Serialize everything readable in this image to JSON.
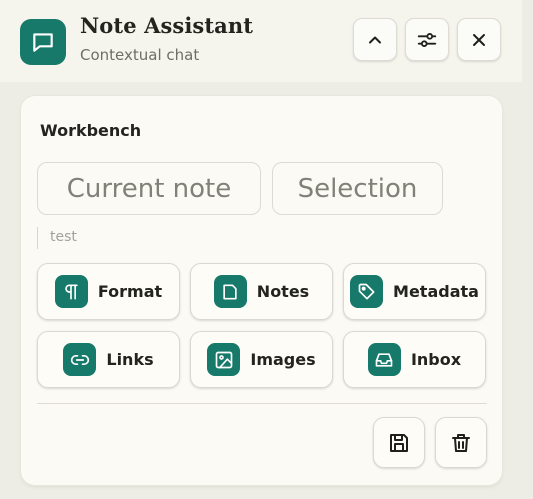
{
  "header": {
    "app_icon": "chat-bubble-icon",
    "title": "Note Assistant",
    "subtitle": "Contextual chat",
    "buttons": [
      {
        "icon": "chevron-up-icon"
      },
      {
        "icon": "sliders-icon"
      },
      {
        "icon": "close-icon"
      }
    ]
  },
  "workbench": {
    "title": "Workbench",
    "context_chips": [
      {
        "label": "Current note"
      },
      {
        "label": "Selection"
      }
    ],
    "input": {
      "value": "test"
    },
    "tools": [
      {
        "label": "Format",
        "icon": "pilcrow-icon"
      },
      {
        "label": "Notes",
        "icon": "note-page-icon"
      },
      {
        "label": "Metadata",
        "icon": "tag-icon"
      },
      {
        "label": "Links",
        "icon": "link-icon"
      },
      {
        "label": "Images",
        "icon": "image-icon"
      },
      {
        "label": "Inbox",
        "icon": "inbox-icon"
      }
    ],
    "actions": [
      {
        "icon": "save-icon"
      },
      {
        "icon": "trash-icon"
      }
    ]
  },
  "colors": {
    "accent": "#16796a",
    "background": "#edede5",
    "card": "#fbfaf4"
  }
}
